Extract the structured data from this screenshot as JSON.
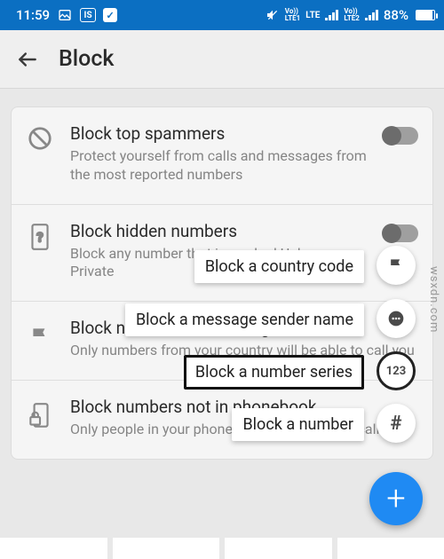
{
  "status": {
    "time": "11:59",
    "battery_pct": "88%",
    "lte_stack_a_top": "Vo))",
    "lte_stack_a_bot": "LTE1",
    "lte_stack_b_top": "Vo))",
    "lte_stack_b_bot": "LTE2",
    "lte_text": "LTE"
  },
  "header": {
    "title": "Block"
  },
  "settings": [
    {
      "title": "Block top spammers",
      "subtitle": "Protect yourself from calls and messages from the most reported numbers"
    },
    {
      "title": "Block hidden numbers",
      "subtitle": "Block any number that is marked Unknown or Private"
    },
    {
      "title": "Block numbers from foreign countries",
      "subtitle": "Only numbers from your country will be able to call you"
    },
    {
      "title": "Block numbers not in phonebook",
      "subtitle": "Only people in your phonebook will be able to call you"
    }
  ],
  "speed_dial": {
    "country_code": "Block a country code",
    "sender_name": "Block a message sender name",
    "number_series": "Block a number series",
    "number": "Block a number",
    "series_badge": "123",
    "hash_badge": "#"
  },
  "watermark": "wsxdn.com"
}
